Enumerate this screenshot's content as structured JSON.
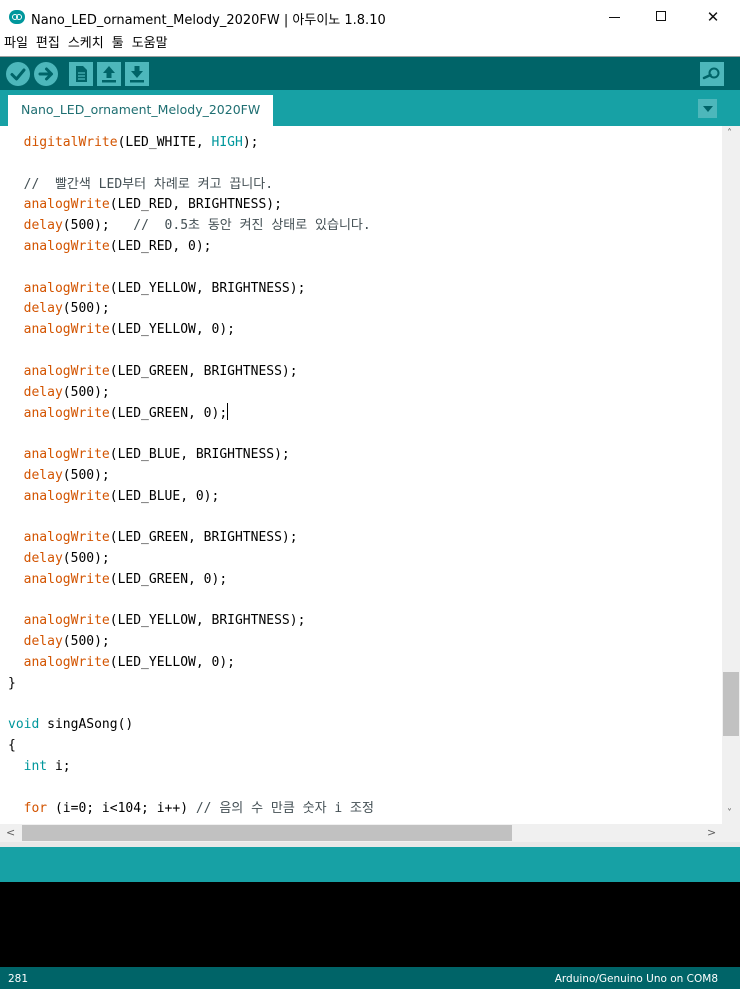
{
  "window": {
    "title": "Nano_LED_ornament_Melody_2020FW | 아두이노 1.8.10",
    "minimize": "",
    "maximize": "",
    "close": "✕"
  },
  "menu": [
    "파일",
    "편집",
    "스케치",
    "툴",
    "도움말"
  ],
  "toolbar": {
    "icons": [
      "check-icon",
      "arrow-right-icon",
      "new-file-icon",
      "open-arrow-up-icon",
      "save-arrow-down-icon",
      "magnifier-icon"
    ]
  },
  "tabs": [
    {
      "label": "Nano_LED_ornament_Melody_2020FW"
    }
  ],
  "editor": {
    "lines": [
      [
        [
          "fn",
          "  digitalWrite"
        ],
        [
          "t",
          "(LED_WHITE, "
        ],
        [
          "cst",
          "HIGH"
        ],
        [
          "t",
          ");"
        ]
      ],
      [],
      [
        [
          "cm",
          "  //  빨간색 LED부터 차례로 켜고 끕니다."
        ]
      ],
      [
        [
          "fn",
          "  analogWrite"
        ],
        [
          "t",
          "(LED_RED, BRIGHTNESS);"
        ]
      ],
      [
        [
          "fn",
          "  delay"
        ],
        [
          "t",
          "(500);   "
        ],
        [
          "cm",
          "//  0.5초 동안 켜진 상태로 있습니다."
        ]
      ],
      [
        [
          "fn",
          "  analogWrite"
        ],
        [
          "t",
          "(LED_RED, 0);"
        ]
      ],
      [],
      [
        [
          "fn",
          "  analogWrite"
        ],
        [
          "t",
          "(LED_YELLOW, BRIGHTNESS);"
        ]
      ],
      [
        [
          "fn",
          "  delay"
        ],
        [
          "t",
          "(500);"
        ]
      ],
      [
        [
          "fn",
          "  analogWrite"
        ],
        [
          "t",
          "(LED_YELLOW, 0);"
        ]
      ],
      [],
      [
        [
          "fn",
          "  analogWrite"
        ],
        [
          "t",
          "(LED_GREEN, BRIGHTNESS);"
        ]
      ],
      [
        [
          "fn",
          "  delay"
        ],
        [
          "t",
          "(500);"
        ]
      ],
      [
        [
          "fn",
          "  analogWrite"
        ],
        [
          "t",
          "(LED_GREEN, 0);"
        ],
        [
          "caret",
          ""
        ]
      ],
      [],
      [
        [
          "fn",
          "  analogWrite"
        ],
        [
          "t",
          "(LED_BLUE, BRIGHTNESS);"
        ]
      ],
      [
        [
          "fn",
          "  delay"
        ],
        [
          "t",
          "(500);"
        ]
      ],
      [
        [
          "fn",
          "  analogWrite"
        ],
        [
          "t",
          "(LED_BLUE, 0);"
        ]
      ],
      [],
      [
        [
          "fn",
          "  analogWrite"
        ],
        [
          "t",
          "(LED_GREEN, BRIGHTNESS);"
        ]
      ],
      [
        [
          "fn",
          "  delay"
        ],
        [
          "t",
          "(500);"
        ]
      ],
      [
        [
          "fn",
          "  analogWrite"
        ],
        [
          "t",
          "(LED_GREEN, 0);"
        ]
      ],
      [],
      [
        [
          "fn",
          "  analogWrite"
        ],
        [
          "t",
          "(LED_YELLOW, BRIGHTNESS);"
        ]
      ],
      [
        [
          "fn",
          "  delay"
        ],
        [
          "t",
          "(500);"
        ]
      ],
      [
        [
          "fn",
          "  analogWrite"
        ],
        [
          "t",
          "(LED_YELLOW, 0);"
        ]
      ],
      [
        [
          "t",
          "}"
        ]
      ],
      [],
      [
        [
          "ty",
          "void"
        ],
        [
          "t",
          " singASong()"
        ]
      ],
      [
        [
          "t",
          "{"
        ]
      ],
      [
        [
          "ty",
          "  int"
        ],
        [
          "t",
          " i;"
        ]
      ],
      [],
      [
        [
          "kw",
          "  for"
        ],
        [
          "t",
          " (i=0; i<104; i++) "
        ],
        [
          "cm",
          "// 음의 수 만큼 숫자 i 조정"
        ]
      ]
    ]
  },
  "scrollbars": {
    "up": "˄",
    "down": "˅",
    "left": "<",
    "right": ">"
  },
  "status": {
    "line_number": "281",
    "board": "Arduino/Genuino Uno on COM8"
  },
  "colors": {
    "toolbar_bg": "#006468",
    "tabstrip_bg": "#17a1a5",
    "button_fill": "#4db7bb",
    "function_color": "#d35400",
    "type_color": "#00979c",
    "comment_color": "#434f54"
  }
}
